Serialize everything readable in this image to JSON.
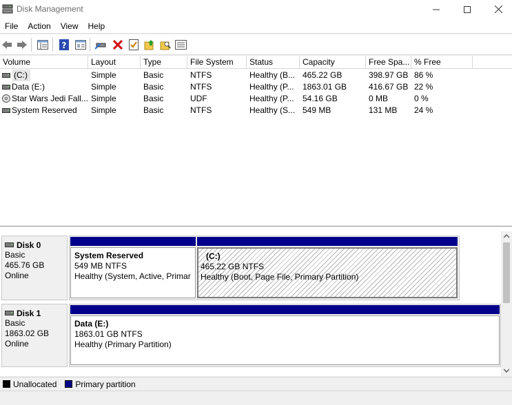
{
  "window": {
    "title": "Disk Management"
  },
  "menu": [
    "File",
    "Action",
    "View",
    "Help"
  ],
  "toolbar": [
    "back-arrow-icon",
    "forward-arrow-icon",
    "show-list-icon",
    "help-icon",
    "properties-icon",
    "connect-icon",
    "delete-icon",
    "check-icon",
    "folder-up-icon",
    "search-folder-icon",
    "list-view-icon"
  ],
  "columns": [
    "Volume",
    "Layout",
    "Type",
    "File System",
    "Status",
    "Capacity",
    "Free Spa...",
    "% Free"
  ],
  "volumes": [
    {
      "volume": "(C:)",
      "layout": "Simple",
      "type": "Basic",
      "fs": "NTFS",
      "status": "Healthy (B...",
      "capacity": "465.22 GB",
      "free": "398.97 GB",
      "pct": "86 %",
      "icon": "drive-icon"
    },
    {
      "volume": "Data (E:)",
      "layout": "Simple",
      "type": "Basic",
      "fs": "NTFS",
      "status": "Healthy (P...",
      "capacity": "1863.01 GB",
      "free": "416.67 GB",
      "pct": "22 %",
      "icon": "drive-icon"
    },
    {
      "volume": "Star Wars Jedi Fall...",
      "layout": "Simple",
      "type": "Basic",
      "fs": "UDF",
      "status": "Healthy (P...",
      "capacity": "54.16 GB",
      "free": "0 MB",
      "pct": "0 %",
      "icon": "disc-icon"
    },
    {
      "volume": "System Reserved",
      "layout": "Simple",
      "type": "Basic",
      "fs": "NTFS",
      "status": "Healthy (S...",
      "capacity": "549 MB",
      "free": "131 MB",
      "pct": "24 %",
      "icon": "drive-icon"
    }
  ],
  "disks": [
    {
      "name": "Disk 0",
      "type": "Basic",
      "size": "465.76 GB",
      "state": "Online",
      "partitions": [
        {
          "name": "System Reserved",
          "size": "549 MB NTFS",
          "status": "Healthy (System, Active, Primar"
        },
        {
          "name": "(C:)",
          "size": "465.22 GB NTFS",
          "status": "Healthy (Boot, Page File, Primary Partition)"
        }
      ]
    },
    {
      "name": "Disk 1",
      "type": "Basic",
      "size": "1863.02 GB",
      "state": "Online",
      "partitions": [
        {
          "name": "Data  (E:)",
          "size": "1863.01 GB NTFS",
          "status": "Healthy (Primary Partition)"
        }
      ]
    }
  ],
  "legend": [
    {
      "label": "Unallocated",
      "color": "#000000"
    },
    {
      "label": "Primary partition",
      "color": "#00008b"
    }
  ],
  "colors": {
    "primary_partition": "#00008b",
    "unallocated": "#000000"
  }
}
